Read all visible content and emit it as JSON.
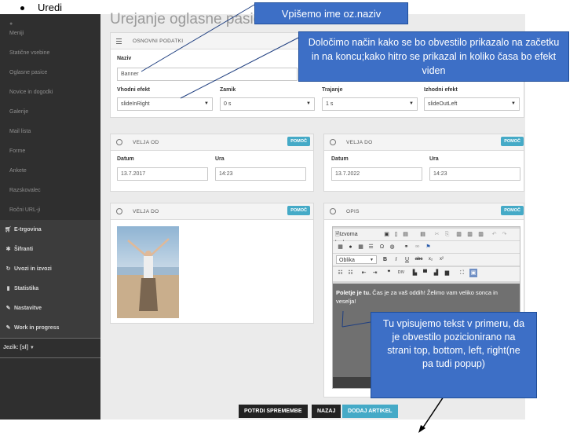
{
  "bullet_text": "Uredi",
  "page_title": "Urejanje oglasne pasice",
  "sidebar": {
    "sub_items": [
      "Meniji",
      "Statične vsebine",
      "Oglasne pasice",
      "Novice in dogodki",
      "Galerije",
      "Mail lista",
      "Forme",
      "Ankete",
      "Razskovalec",
      "Ročni URL-ji"
    ],
    "main_items": [
      {
        "icon": "cart-icon",
        "label": "E-trgovina"
      },
      {
        "icon": "gear-icon",
        "label": "Šifranti"
      },
      {
        "icon": "refresh-icon",
        "label": "Uvozi in izvozi"
      },
      {
        "icon": "bar-chart-icon",
        "label": "Statistika"
      },
      {
        "icon": "wrench-icon",
        "label": "Nastavitve"
      },
      {
        "icon": "wrench-icon",
        "label": "Work in progress"
      }
    ],
    "language": "Jezik: [sl]"
  },
  "basic": {
    "title": "OSNOVNI PODATKI",
    "name_label": "Naziv",
    "name_value": "Banner",
    "fields": [
      {
        "label": "Vhodni efekt",
        "value": "slideInRight"
      },
      {
        "label": "Zamik",
        "value": "0 s"
      },
      {
        "label": "Trajanje",
        "value": "1 s"
      },
      {
        "label": "Izhodni efekt",
        "value": "slideOutLeft"
      }
    ]
  },
  "valid_from": {
    "title": "VELJA OD",
    "help": "POMOČ",
    "date_label": "Datum",
    "date_value": "13.7.2017",
    "time_label": "Ura",
    "time_value": "14:23"
  },
  "valid_to": {
    "title": "VELJA DO",
    "help": "POMOČ",
    "date_label": "Datum",
    "date_value": "13.7.2022",
    "time_label": "Ura",
    "time_value": "14:23"
  },
  "image_panel": {
    "title": "VELJA DO",
    "help": "POMOČ"
  },
  "desc_panel": {
    "title": "OPIS",
    "help": "POMOČ",
    "source_label": "Izvorna koda",
    "format_label": "Oblika",
    "bold_text": "Poletje je tu.",
    "body_text": " Čas je za vaš oddih! Želimo vam veliko sonca in veselja!"
  },
  "buttons": {
    "confirm": "POTRDI SPREMEMBE",
    "back": "NAZAJ",
    "add": "DODAJ ARTIKEL"
  },
  "callouts": {
    "name": "Vpišemo ime oz.naziv",
    "effect": "Določimo način kako se bo obvestilo prikazalo na začetku in na koncu;kako hitro se prikazal in koliko časa bo efekt viden",
    "text": "Tu vpisujemo tekst v primeru, da je obvestilo pozicionirano na strani top, bottom, left, right(ne pa tudi popup)"
  }
}
